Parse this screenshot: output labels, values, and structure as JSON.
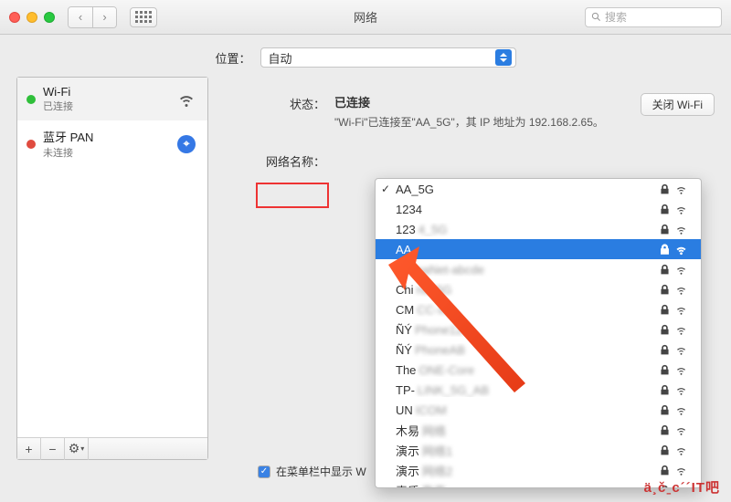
{
  "window": {
    "title": "网络",
    "search_placeholder": "搜索"
  },
  "location": {
    "label": "位置：",
    "value": "自动"
  },
  "services": [
    {
      "name": "Wi-Fi",
      "status": "已连接",
      "dot": "green",
      "icon": "wifi"
    },
    {
      "name": "蓝牙 PAN",
      "status": "未连接",
      "dot": "red",
      "icon": "bluetooth"
    }
  ],
  "sidebar_footer": {
    "add": "+",
    "remove": "−",
    "gear": "⚙"
  },
  "status": {
    "label": "状态：",
    "value": "已连接",
    "desc": "\"Wi-Fi\"已连接至\"AA_5G\"，其 IP 地址为 192.168.2.65。",
    "off_button": "关闭 Wi-Fi"
  },
  "network_name": {
    "label": "网络名称：",
    "current": "AA_5G",
    "options": [
      {
        "name": "AA_5G",
        "checked": true,
        "locked": true,
        "blur": ""
      },
      {
        "name": "1234",
        "locked": true,
        "blur": ""
      },
      {
        "name": "123",
        "locked": true,
        "blur": "4_5G"
      },
      {
        "name": "AA",
        "locked": true,
        "selected": true,
        "blur": ""
      },
      {
        "name": "Chi",
        "locked": true,
        "blur": "naNet-abcde"
      },
      {
        "name": "Chi",
        "locked": true,
        "blur": "na_5G"
      },
      {
        "name": "CM",
        "locked": true,
        "blur": "CC-xxx"
      },
      {
        "name": "ÑÝ",
        "locked": true,
        "blur": "Phone123"
      },
      {
        "name": "ÑÝ",
        "locked": true,
        "blur": "PhoneAB"
      },
      {
        "name": "The",
        "locked": true,
        "blur": "ONE-Core"
      },
      {
        "name": "TP-",
        "locked": true,
        "blur": "LINK_5G_AB"
      },
      {
        "name": "UN",
        "locked": true,
        "blur": "ICOM"
      },
      {
        "name": "木易",
        "locked": true,
        "blur": "网络"
      },
      {
        "name": "演示",
        "locked": true,
        "blur": "网络1"
      },
      {
        "name": "演示",
        "locked": true,
        "blur": "网络2"
      },
      {
        "name": "素质",
        "locked": true,
        "blur": "教育"
      }
    ]
  },
  "menubar_checkbox": "在菜单栏中显示 W",
  "watermark": "ä¸čˍc´´IT吧"
}
